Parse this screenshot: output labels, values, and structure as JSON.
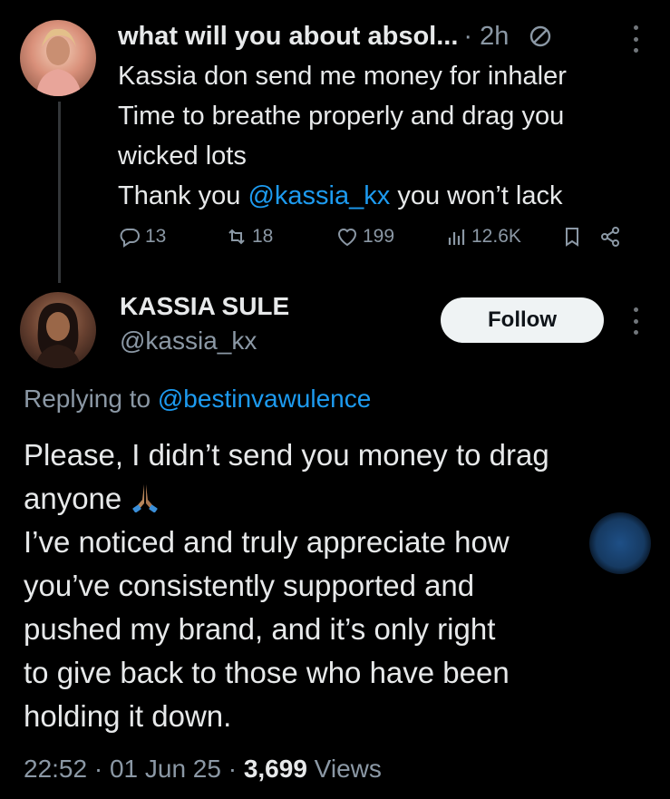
{
  "tweet1": {
    "display_name": "what will you about absol...",
    "time": "2h",
    "lines": [
      "Kassia don send me money for inhaler",
      "Time to breathe properly and drag you",
      "wicked lots"
    ],
    "thanks_prefix": "Thank you ",
    "thanks_mention": "@kassia_kx",
    "thanks_suffix": " you won’t lack",
    "replies": "13",
    "reposts": "18",
    "likes": "199",
    "views": "12.6K"
  },
  "tweet2": {
    "display_name": "KASSIA SULE",
    "handle": "@kassia_kx",
    "follow_label": "Follow",
    "replying_prefix": "Replying to ",
    "replying_mention": "@bestinvawulence",
    "line1": "Please, I didn’t send you money to drag",
    "line2": "anyone ",
    "paragraph": [
      "I’ve noticed and truly appreciate how",
      "you’ve consistently supported and",
      "pushed my brand, and it’s only right",
      "to give back to those who have been",
      "holding it down."
    ],
    "time": "22:52 · 01 Jun 25 · ",
    "views_count": "3,699",
    "views_label": " Views"
  },
  "colors": {
    "background": "#000000",
    "text": "#e7e9ea",
    "muted": "#8b98a5",
    "link": "#1d9bf0",
    "follow_bg": "#eff3f4"
  },
  "icons": [
    "user-avatar",
    "ban-icon",
    "more-icon",
    "reply-icon",
    "repost-icon",
    "like-icon",
    "views-icon",
    "bookmark-icon",
    "share-icon",
    "pray-emoji"
  ]
}
